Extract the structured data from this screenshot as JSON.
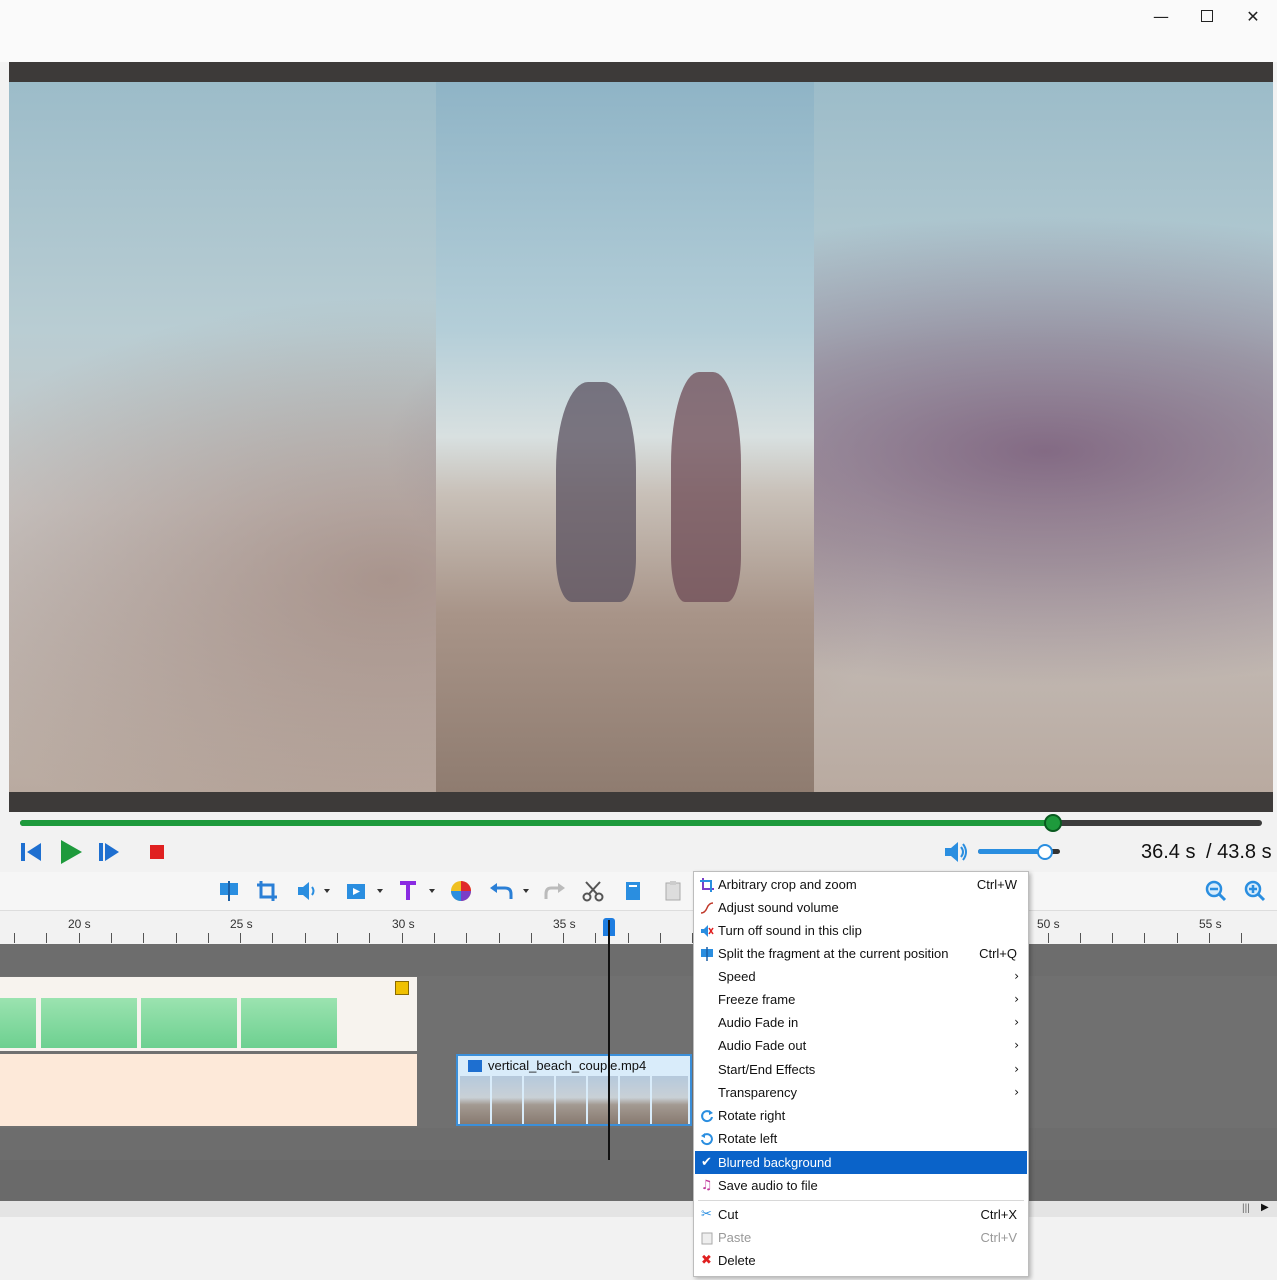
{
  "window": {
    "minimize_icon": "minimize-icon",
    "maximize_icon": "maximize-icon",
    "close_icon": "close-icon"
  },
  "player": {
    "progress_fraction": 0.831,
    "current_time": "36.4 s",
    "total_time": "/ 43.8 s",
    "volume_fraction": 0.8
  },
  "timeline": {
    "ruler_labels": [
      {
        "label": "20 s"
      },
      {
        "label": "25 s"
      },
      {
        "label": "30 s"
      },
      {
        "label": "35 s"
      },
      {
        "label": "50 s"
      },
      {
        "label": "55 s"
      }
    ],
    "clip_name": "vertical_beach_couple.mp4"
  },
  "context_menu": {
    "items": [
      {
        "label": "Arbitrary crop and zoom",
        "shortcut": "Ctrl+W",
        "icon": "crop-icon"
      },
      {
        "label": "Adjust sound volume",
        "shortcut": "",
        "icon": "volume-curve-icon"
      },
      {
        "label": "Turn off sound in this clip",
        "shortcut": "",
        "icon": "mute-icon"
      },
      {
        "label": "Split the fragment at the current position",
        "shortcut": "Ctrl+Q",
        "icon": "split-icon"
      },
      {
        "label": "Speed",
        "shortcut": "",
        "icon": ""
      },
      {
        "label": "Freeze frame",
        "shortcut": "",
        "icon": ""
      },
      {
        "label": "Audio Fade in",
        "shortcut": "",
        "icon": ""
      },
      {
        "label": "Audio Fade out",
        "shortcut": "",
        "icon": ""
      },
      {
        "label": "Start/End Effects",
        "shortcut": "",
        "icon": ""
      },
      {
        "label": "Transparency",
        "shortcut": "",
        "icon": ""
      },
      {
        "label": "Rotate right",
        "shortcut": "",
        "icon": "rotate-right-icon"
      },
      {
        "label": "Rotate left",
        "shortcut": "",
        "icon": "rotate-left-icon"
      },
      {
        "label": "Blurred background",
        "shortcut": "",
        "icon": "checkmark-icon"
      },
      {
        "label": "Save audio to file",
        "shortcut": "",
        "icon": "music-note-icon"
      },
      {
        "label": "Cut",
        "shortcut": "Ctrl+X",
        "icon": "scissors-icon"
      },
      {
        "label": "Paste",
        "shortcut": "Ctrl+V",
        "icon": "paste-icon"
      },
      {
        "label": "Delete",
        "shortcut": "",
        "icon": "delete-icon"
      }
    ],
    "submenu_arrow": "›"
  },
  "colors": {
    "accent_green": "#1e9a3c",
    "menu_highlight": "#0a63c9",
    "playhead": "#1e7de0"
  }
}
